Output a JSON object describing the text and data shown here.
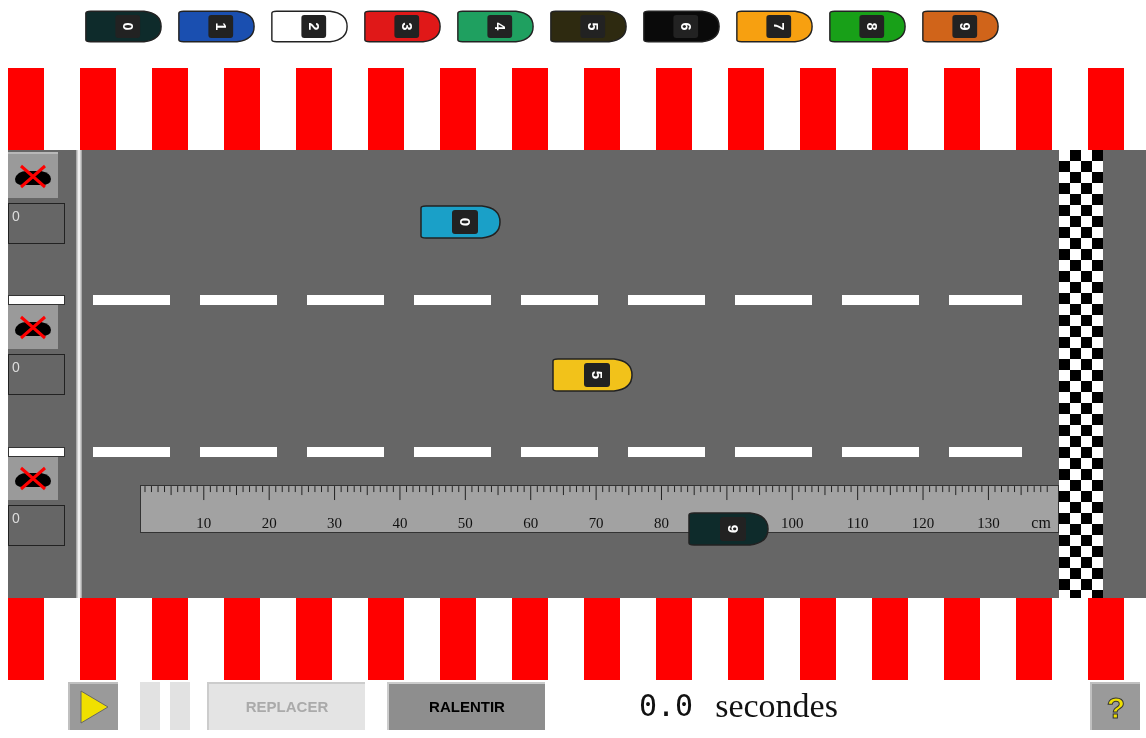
{
  "palette": [
    {
      "number": "0",
      "color": "#0e2b2b"
    },
    {
      "number": "1",
      "color": "#1a4fb0"
    },
    {
      "number": "2",
      "color": "#ffffff"
    },
    {
      "number": "3",
      "color": "#e01818"
    },
    {
      "number": "4",
      "color": "#1fa060"
    },
    {
      "number": "5",
      "color": "#2e2a10"
    },
    {
      "number": "6",
      "color": "#0a0a0a"
    },
    {
      "number": "7",
      "color": "#f7a010"
    },
    {
      "number": "8",
      "color": "#18a018"
    },
    {
      "number": "9",
      "color": "#d0641a"
    }
  ],
  "lanes": [
    {
      "counter": "0",
      "car": {
        "number": "0",
        "color": "#1aa0c8"
      }
    },
    {
      "counter": "0",
      "car": {
        "number": "5",
        "color": "#f2c21a"
      }
    },
    {
      "counter": "0",
      "car": {
        "number": "9",
        "color": "#0e2b2b"
      }
    }
  ],
  "ruler": {
    "labels": [
      "10",
      "20",
      "30",
      "40",
      "50",
      "60",
      "70",
      "80",
      "100",
      "110",
      "120",
      "130"
    ],
    "unit": "cm"
  },
  "controls": {
    "play": {
      "disabled": false
    },
    "pause": {
      "disabled": true
    },
    "reset": {
      "label": "REPLACER",
      "disabled": true
    },
    "slow": {
      "label": "RALENTIR",
      "disabled": false
    },
    "help": {
      "label": "?"
    }
  },
  "timer": {
    "value": "0.0",
    "unit": "secondes"
  }
}
